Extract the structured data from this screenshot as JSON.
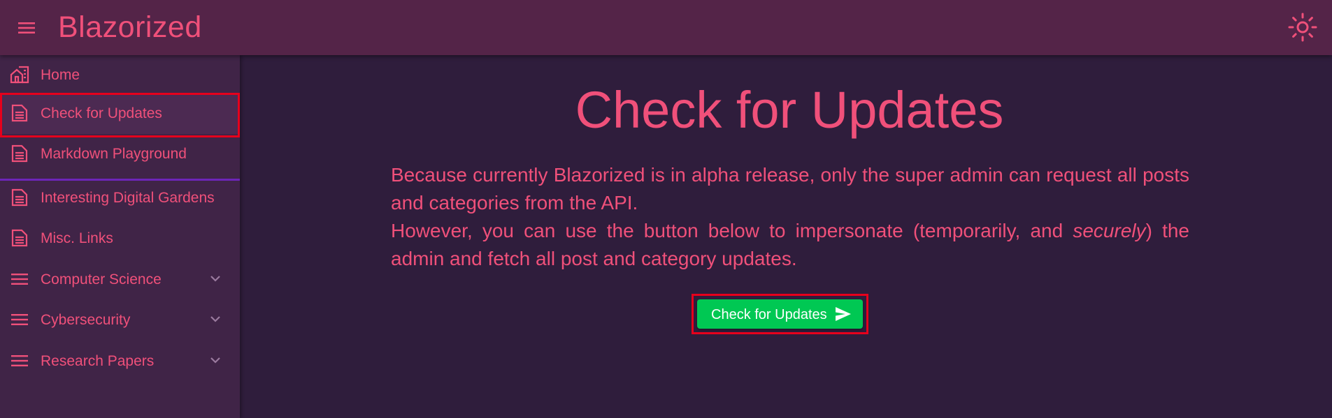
{
  "app": {
    "title": "Blazorized"
  },
  "icons": {
    "menu": "menu-icon",
    "theme": "sun-icon",
    "home": "home-icon",
    "page": "document-icon",
    "group": "list-icon",
    "expand": "chevron-down-icon",
    "send": "send-icon"
  },
  "colors": {
    "accent": "#f0507a",
    "appbar": "#542448",
    "sidebar": "#402447",
    "background": "#2f1d3c",
    "button": "#00c853",
    "divider": "#6d25b8",
    "highlight": "#e6001c"
  },
  "sidebar": {
    "items": [
      {
        "label": "Home"
      },
      {
        "label": "Check for Updates"
      },
      {
        "label": "Markdown Playground"
      },
      {
        "label": "Interesting Digital Gardens"
      },
      {
        "label": "Misc. Links"
      },
      {
        "label": "Computer Science"
      },
      {
        "label": "Cybersecurity"
      },
      {
        "label": "Research Papers"
      }
    ]
  },
  "main": {
    "title": "Check for Updates",
    "paragraph1": "Because currently Blazorized is in alpha release, only the super admin can request all posts and categories from the API.",
    "paragraph2_start": "However, you can use the button below to impersonate (temporarily, and ",
    "paragraph2_emphasis": "securely",
    "paragraph2_end": ") the admin and fetch all post and category updates.",
    "button_label": "Check for Updates"
  }
}
